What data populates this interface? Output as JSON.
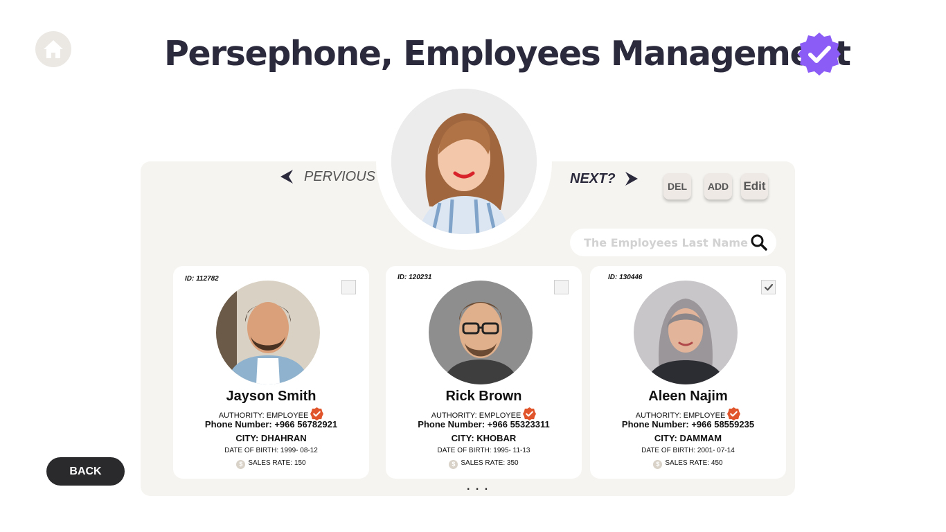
{
  "header": {
    "title": "Persephone, Employees Management",
    "home_icon": "home-icon",
    "verified_icon": "verified-badge-icon"
  },
  "nav": {
    "previous_label": "PERVIOUS",
    "next_label": "NEXT?"
  },
  "actions": {
    "del_label": "DEL",
    "add_label": "ADD",
    "edit_label": "Edit"
  },
  "search": {
    "placeholder": "The Employees Last Name",
    "icon": "search-icon"
  },
  "employees": [
    {
      "id": "ID: 112782",
      "name": "Jayson Smith",
      "authority": "AUTHORITY: EMPLOYEE",
      "phone": "Phone Number: +966 56782921",
      "city": "CITY: DHAHRAN",
      "dob": "DATE OF BIRTH: 1999- 08-12",
      "sales": "SALES RATE: 150",
      "checked": false
    },
    {
      "id": "ID: 120231",
      "name": "Rick Brown",
      "authority": "AUTHORITY: EMPLOYEE",
      "phone": "Phone Number: +966 55323311",
      "city": "CITY: KHOBAR",
      "dob": "DATE OF BIRTH: 1995- 11-13",
      "sales": "SALES RATE: 350",
      "checked": false
    },
    {
      "id": "ID: 130446",
      "name": "Aleen Najim",
      "authority": "AUTHORITY: EMPLOYEE",
      "phone": "Phone Number: +966 58559235",
      "city": "CITY: DAMMAM",
      "dob": "DATE OF BIRTH: 2001- 07-14",
      "sales": "SALES RATE: 450",
      "checked": true
    }
  ],
  "pagination": {
    "more": ". . ."
  },
  "back_label": "BACK",
  "colors": {
    "title": "#2b2a3d",
    "verified_badge": "#8b5cf6",
    "employee_badge": "#e0552b",
    "panel": "#f6f4f0",
    "back_button": "#2a2a2d"
  }
}
